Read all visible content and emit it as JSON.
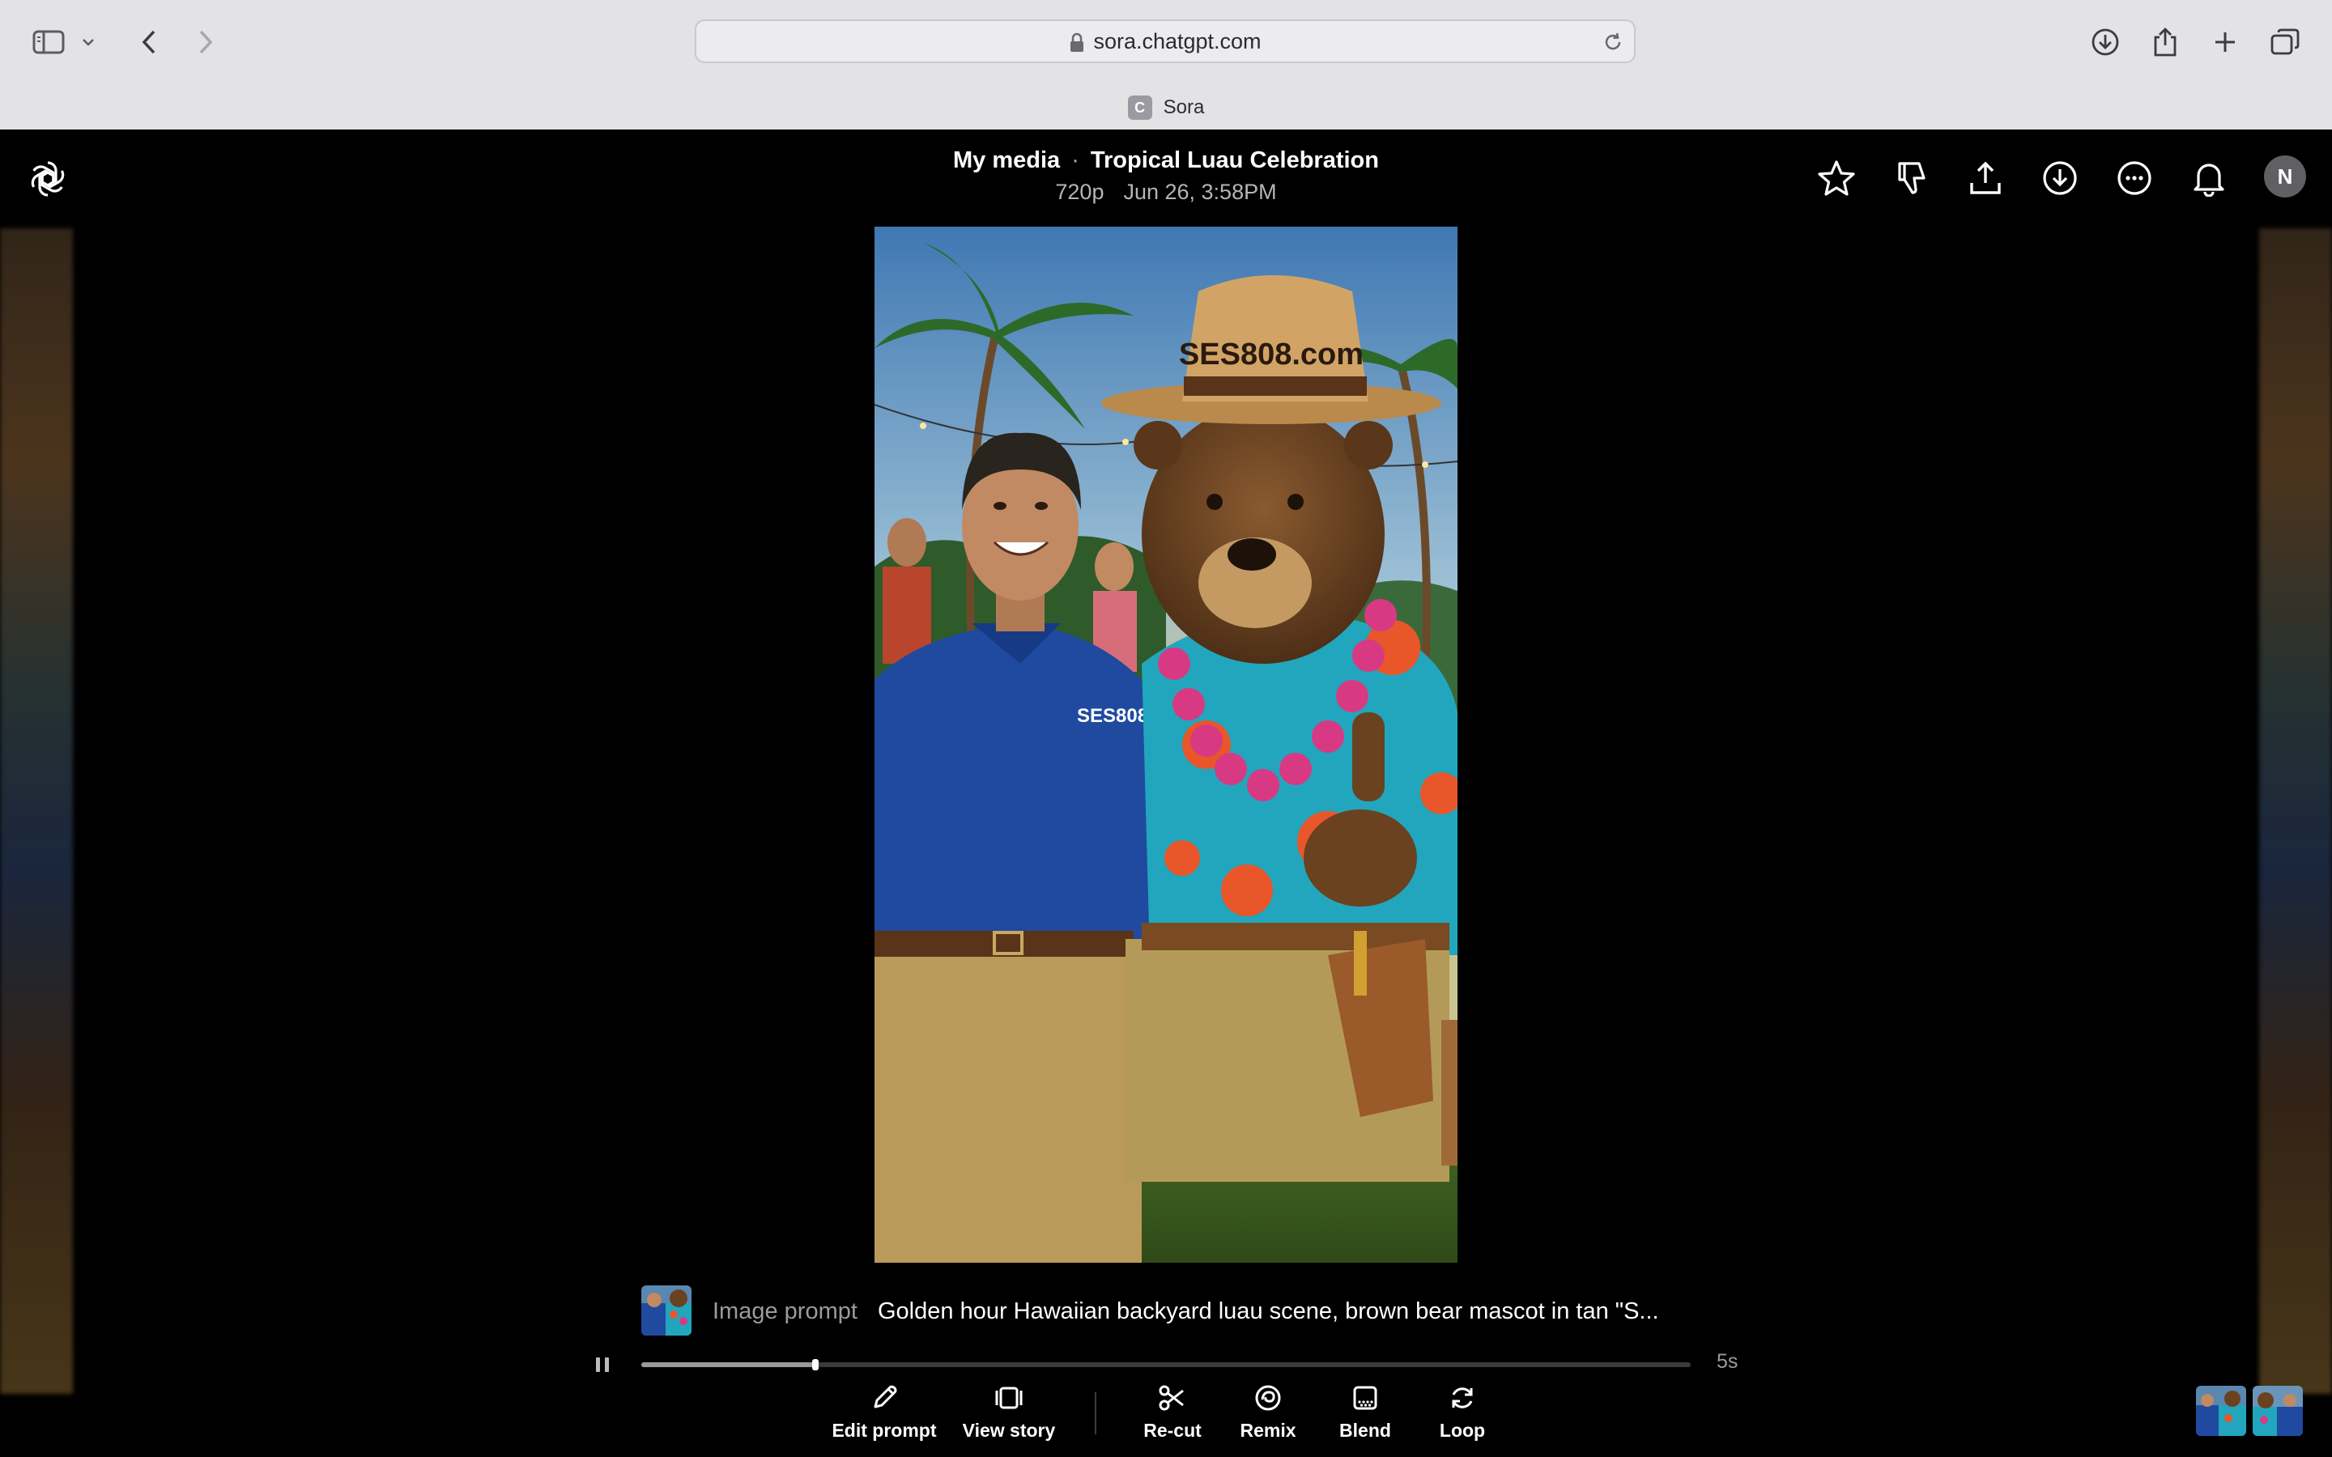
{
  "browser": {
    "url": "sora.chatgpt.com",
    "tab_title": "Sora",
    "tab_favicon_letter": "C"
  },
  "header": {
    "breadcrumb_parent": "My media",
    "separator": "·",
    "title": "Tropical Luau Celebration",
    "resolution": "720p",
    "timestamp": "Jun 26, 3:58PM",
    "avatar_initial": "N"
  },
  "video": {
    "hat_text": "SES808.com",
    "shirt_text": "SES808"
  },
  "prompt": {
    "label": "Image prompt",
    "text": "Golden hour Hawaiian backyard luau scene, brown bear mascot in tan \"S..."
  },
  "playback": {
    "progress": 0.166,
    "duration": "5s"
  },
  "actions": {
    "edit_prompt": "Edit prompt",
    "view_story": "View story",
    "recut": "Re-cut",
    "remix": "Remix",
    "blend": "Blend",
    "loop": "Loop"
  }
}
